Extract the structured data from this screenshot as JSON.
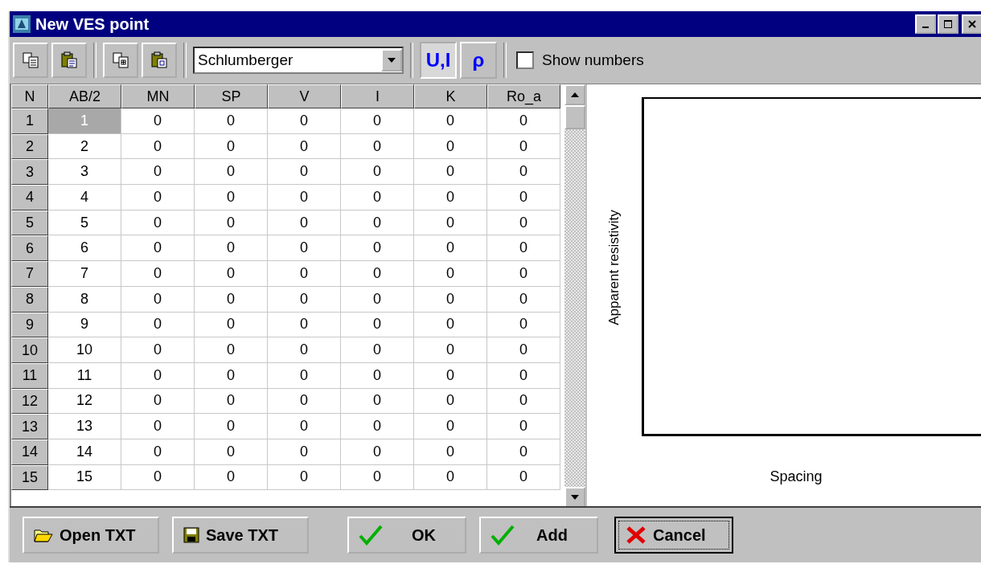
{
  "window": {
    "title": "New VES point"
  },
  "toolbar": {
    "buttons": [
      {
        "kind": "copy"
      },
      {
        "kind": "paste"
      },
      {
        "kind": "copy-table"
      },
      {
        "kind": "paste-table"
      }
    ],
    "array_type": {
      "value": "Schlumberger"
    },
    "modes": [
      {
        "label": "U,I",
        "selected": true
      },
      {
        "label": "ρ",
        "selected": false
      }
    ],
    "show_numbers": {
      "label": "Show numbers",
      "checked": false
    }
  },
  "grid": {
    "columns": [
      "N",
      "AB/2",
      "MN",
      "SP",
      "V",
      "I",
      "K",
      "Ro_a"
    ],
    "rows": [
      {
        "cells": [
          {
            "text": "1",
            "selected": false
          },
          {
            "text": "1",
            "selected": true
          },
          {
            "text": "0",
            "selected": false
          },
          {
            "text": "0",
            "selected": false
          },
          {
            "text": "0",
            "selected": false
          },
          {
            "text": "0",
            "selected": false
          },
          {
            "text": "0",
            "selected": false
          },
          {
            "text": "0",
            "selected": false
          }
        ]
      },
      {
        "cells": [
          {
            "text": "2",
            "selected": false
          },
          {
            "text": "2",
            "selected": false
          },
          {
            "text": "0",
            "selected": false
          },
          {
            "text": "0",
            "selected": false
          },
          {
            "text": "0",
            "selected": false
          },
          {
            "text": "0",
            "selected": false
          },
          {
            "text": "0",
            "selected": false
          },
          {
            "text": "0",
            "selected": false
          }
        ]
      },
      {
        "cells": [
          {
            "text": "3",
            "selected": false
          },
          {
            "text": "3",
            "selected": false
          },
          {
            "text": "0",
            "selected": false
          },
          {
            "text": "0",
            "selected": false
          },
          {
            "text": "0",
            "selected": false
          },
          {
            "text": "0",
            "selected": false
          },
          {
            "text": "0",
            "selected": false
          },
          {
            "text": "0",
            "selected": false
          }
        ]
      },
      {
        "cells": [
          {
            "text": "4",
            "selected": false
          },
          {
            "text": "4",
            "selected": false
          },
          {
            "text": "0",
            "selected": false
          },
          {
            "text": "0",
            "selected": false
          },
          {
            "text": "0",
            "selected": false
          },
          {
            "text": "0",
            "selected": false
          },
          {
            "text": "0",
            "selected": false
          },
          {
            "text": "0",
            "selected": false
          }
        ]
      },
      {
        "cells": [
          {
            "text": "5",
            "selected": false
          },
          {
            "text": "5",
            "selected": false
          },
          {
            "text": "0",
            "selected": false
          },
          {
            "text": "0",
            "selected": false
          },
          {
            "text": "0",
            "selected": false
          },
          {
            "text": "0",
            "selected": false
          },
          {
            "text": "0",
            "selected": false
          },
          {
            "text": "0",
            "selected": false
          }
        ]
      },
      {
        "cells": [
          {
            "text": "6",
            "selected": false
          },
          {
            "text": "6",
            "selected": false
          },
          {
            "text": "0",
            "selected": false
          },
          {
            "text": "0",
            "selected": false
          },
          {
            "text": "0",
            "selected": false
          },
          {
            "text": "0",
            "selected": false
          },
          {
            "text": "0",
            "selected": false
          },
          {
            "text": "0",
            "selected": false
          }
        ]
      },
      {
        "cells": [
          {
            "text": "7",
            "selected": false
          },
          {
            "text": "7",
            "selected": false
          },
          {
            "text": "0",
            "selected": false
          },
          {
            "text": "0",
            "selected": false
          },
          {
            "text": "0",
            "selected": false
          },
          {
            "text": "0",
            "selected": false
          },
          {
            "text": "0",
            "selected": false
          },
          {
            "text": "0",
            "selected": false
          }
        ]
      },
      {
        "cells": [
          {
            "text": "8",
            "selected": false
          },
          {
            "text": "8",
            "selected": false
          },
          {
            "text": "0",
            "selected": false
          },
          {
            "text": "0",
            "selected": false
          },
          {
            "text": "0",
            "selected": false
          },
          {
            "text": "0",
            "selected": false
          },
          {
            "text": "0",
            "selected": false
          },
          {
            "text": "0",
            "selected": false
          }
        ]
      },
      {
        "cells": [
          {
            "text": "9",
            "selected": false
          },
          {
            "text": "9",
            "selected": false
          },
          {
            "text": "0",
            "selected": false
          },
          {
            "text": "0",
            "selected": false
          },
          {
            "text": "0",
            "selected": false
          },
          {
            "text": "0",
            "selected": false
          },
          {
            "text": "0",
            "selected": false
          },
          {
            "text": "0",
            "selected": false
          }
        ]
      },
      {
        "cells": [
          {
            "text": "10",
            "selected": false
          },
          {
            "text": "10",
            "selected": false
          },
          {
            "text": "0",
            "selected": false
          },
          {
            "text": "0",
            "selected": false
          },
          {
            "text": "0",
            "selected": false
          },
          {
            "text": "0",
            "selected": false
          },
          {
            "text": "0",
            "selected": false
          },
          {
            "text": "0",
            "selected": false
          }
        ]
      },
      {
        "cells": [
          {
            "text": "11",
            "selected": false
          },
          {
            "text": "11",
            "selected": false
          },
          {
            "text": "0",
            "selected": false
          },
          {
            "text": "0",
            "selected": false
          },
          {
            "text": "0",
            "selected": false
          },
          {
            "text": "0",
            "selected": false
          },
          {
            "text": "0",
            "selected": false
          },
          {
            "text": "0",
            "selected": false
          }
        ]
      },
      {
        "cells": [
          {
            "text": "12",
            "selected": false
          },
          {
            "text": "12",
            "selected": false
          },
          {
            "text": "0",
            "selected": false
          },
          {
            "text": "0",
            "selected": false
          },
          {
            "text": "0",
            "selected": false
          },
          {
            "text": "0",
            "selected": false
          },
          {
            "text": "0",
            "selected": false
          },
          {
            "text": "0",
            "selected": false
          }
        ]
      },
      {
        "cells": [
          {
            "text": "13",
            "selected": false
          },
          {
            "text": "13",
            "selected": false
          },
          {
            "text": "0",
            "selected": false
          },
          {
            "text": "0",
            "selected": false
          },
          {
            "text": "0",
            "selected": false
          },
          {
            "text": "0",
            "selected": false
          },
          {
            "text": "0",
            "selected": false
          },
          {
            "text": "0",
            "selected": false
          }
        ]
      },
      {
        "cells": [
          {
            "text": "14",
            "selected": false
          },
          {
            "text": "14",
            "selected": false
          },
          {
            "text": "0",
            "selected": false
          },
          {
            "text": "0",
            "selected": false
          },
          {
            "text": "0",
            "selected": false
          },
          {
            "text": "0",
            "selected": false
          },
          {
            "text": "0",
            "selected": false
          },
          {
            "text": "0",
            "selected": false
          }
        ]
      },
      {
        "cells": [
          {
            "text": "15",
            "selected": false
          },
          {
            "text": "15",
            "selected": false
          },
          {
            "text": "0",
            "selected": false
          },
          {
            "text": "0",
            "selected": false
          },
          {
            "text": "0",
            "selected": false
          },
          {
            "text": "0",
            "selected": false
          },
          {
            "text": "0",
            "selected": false
          },
          {
            "text": "0",
            "selected": false
          }
        ]
      }
    ]
  },
  "plot": {
    "ylabel": "Apparent resistivity",
    "xlabel": "Spacing"
  },
  "buttons": [
    {
      "label": "Open TXT",
      "kind": "open"
    },
    {
      "label": "Save TXT",
      "kind": "save"
    },
    {
      "label": "OK",
      "kind": "ok"
    },
    {
      "label": "Add",
      "kind": "add"
    },
    {
      "label": "Cancel",
      "kind": "cancel"
    }
  ]
}
